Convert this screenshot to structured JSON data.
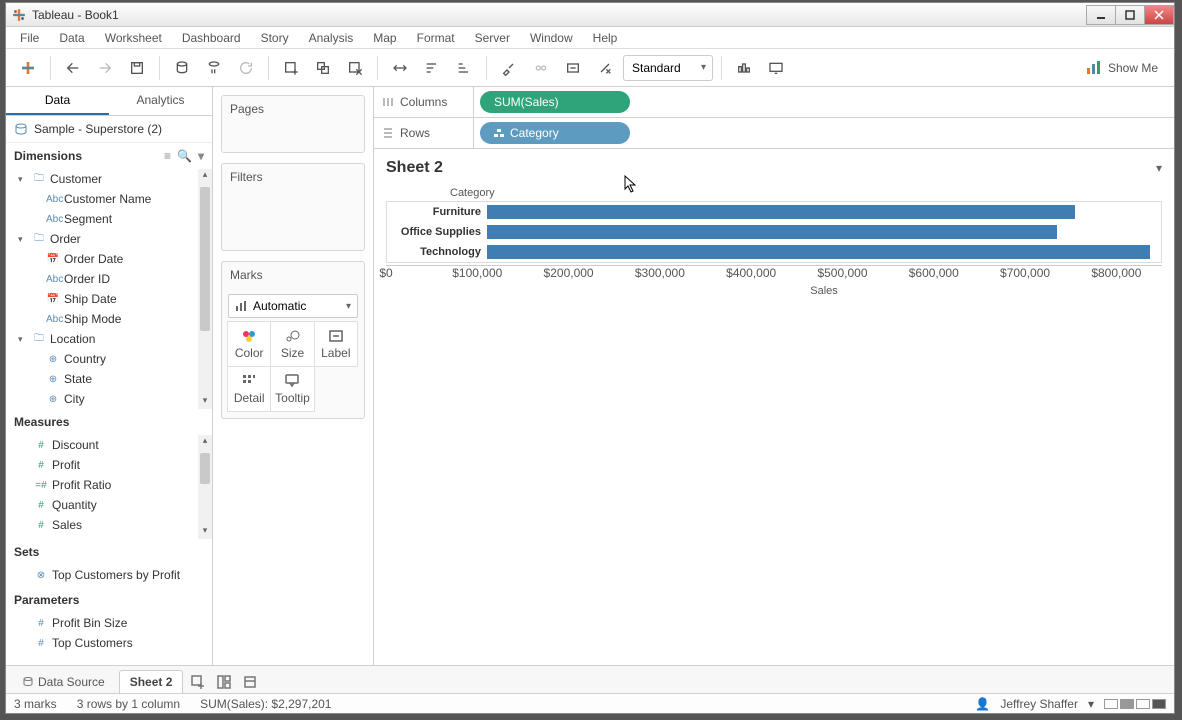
{
  "app_title": "Tableau - Book1",
  "menus": [
    "File",
    "Data",
    "Worksheet",
    "Dashboard",
    "Story",
    "Analysis",
    "Map",
    "Format",
    "Server",
    "Window",
    "Help"
  ],
  "toolbar": {
    "fit_mode": "Standard",
    "show_me": "Show Me"
  },
  "side_tabs": {
    "data": "Data",
    "analytics": "Analytics"
  },
  "datasource": "Sample - Superstore (2)",
  "dimensions_label": "Dimensions",
  "measures_label": "Measures",
  "sets_label": "Sets",
  "parameters_label": "Parameters",
  "dimensions": {
    "customer": {
      "label": "Customer",
      "children": [
        "Customer Name",
        "Segment"
      ]
    },
    "order": {
      "label": "Order",
      "children": [
        "Order Date",
        "Order ID",
        "Ship Date",
        "Ship Mode"
      ]
    },
    "location": {
      "label": "Location",
      "children": [
        "Country",
        "State",
        "City"
      ]
    }
  },
  "measures": [
    "Discount",
    "Profit",
    "Profit Ratio",
    "Quantity",
    "Sales"
  ],
  "sets": [
    "Top Customers by Profit"
  ],
  "parameters": [
    "Profit Bin Size",
    "Top Customers"
  ],
  "shelves": {
    "pages": "Pages",
    "filters": "Filters",
    "marks": "Marks"
  },
  "marks": {
    "type": "Automatic",
    "cells": [
      "Color",
      "Size",
      "Label",
      "Detail",
      "Tooltip"
    ]
  },
  "columns_label": "Columns",
  "rows_label": "Rows",
  "columns_pill": "SUM(Sales)",
  "rows_pill": "Category",
  "sheet_title": "Sheet 2",
  "chart_data": {
    "type": "bar",
    "row_header": "Category",
    "categories": [
      "Furniture",
      "Office Supplies",
      "Technology"
    ],
    "values": [
      742000,
      719000,
      836000
    ],
    "xlabel": "Sales",
    "xlim": [
      0,
      850000
    ],
    "ticks": [
      0,
      100000,
      200000,
      300000,
      400000,
      500000,
      600000,
      700000,
      800000
    ],
    "tick_labels": [
      "$0",
      "$100,000",
      "$200,000",
      "$300,000",
      "$400,000",
      "$500,000",
      "$600,000",
      "$700,000",
      "$800,000"
    ]
  },
  "sheet_tabs": {
    "datasource": "Data Source",
    "active": "Sheet 2"
  },
  "status": {
    "marks": "3 marks",
    "rows": "3 rows by 1 column",
    "sum": "SUM(Sales): $2,297,201",
    "user": "Jeffrey Shaffer"
  }
}
